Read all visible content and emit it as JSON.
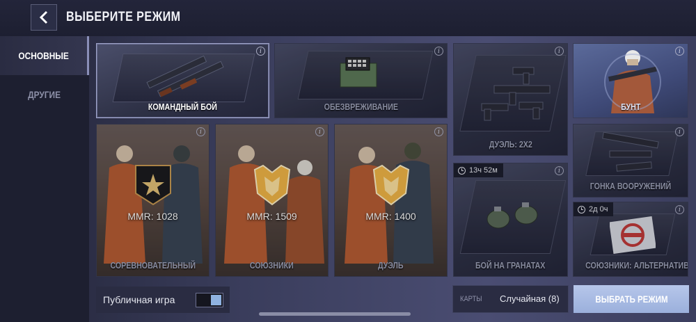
{
  "header": {
    "title": "ВЫБЕРИТЕ РЕЖИМ",
    "back_icon": "chevron-left-icon"
  },
  "sidebar": {
    "items": [
      {
        "label": "ОСНОВНЫЕ",
        "active": true
      },
      {
        "label": "ДРУГИЕ",
        "active": false
      }
    ]
  },
  "modes": [
    {
      "label": "КОМАНДНЫЙ БОЙ",
      "selected": true
    },
    {
      "label": "ОБЕЗВРЕЖИВАНИЕ"
    },
    {
      "label": "ДУЭЛЬ: 2Х2"
    },
    {
      "label": "БУНТ"
    },
    {
      "label": "СОРЕВНОВАТЕЛЬНЫЙ",
      "mmr": "MMR: 1028"
    },
    {
      "label": "СОЮЗНИКИ",
      "mmr": "MMR: 1509"
    },
    {
      "label": "ДУЭЛЬ",
      "mmr": "MMR: 1400"
    },
    {
      "label": "ГОНКА ВООРУЖЕНИЙ"
    },
    {
      "label": "БОЙ НА ГРАНАТАХ",
      "timer": "13ч 52м"
    },
    {
      "label": "СОЮЗНИКИ: АЛЬТЕРНАТИВА",
      "timer": "2д 0ч"
    }
  ],
  "info_glyph": "i",
  "footer": {
    "public_game_label": "Публичная игра",
    "public_game_on": true,
    "maps_label": "КАРТЫ",
    "maps_value": "Случайная (8)",
    "select_button": "ВЫБРАТЬ РЕЖИМ"
  },
  "colors": {
    "accent_button": "#a9bbe4",
    "toggle_on": "#8fb2e0",
    "background": "#1a1c2b"
  }
}
